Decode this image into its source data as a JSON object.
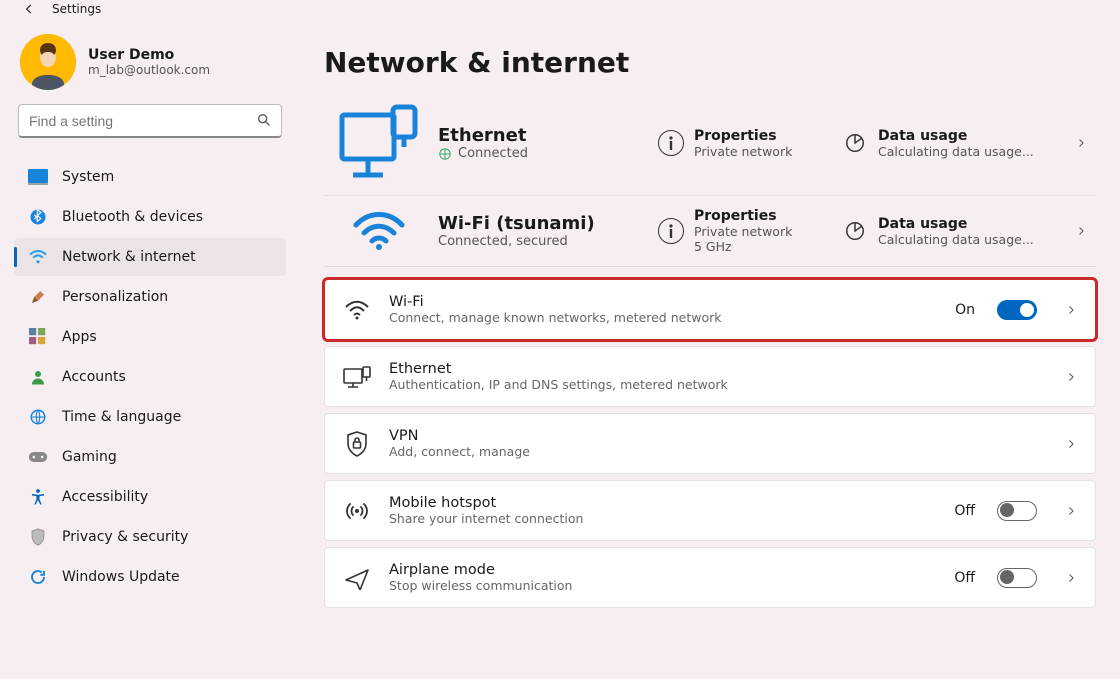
{
  "window": {
    "title": "Settings"
  },
  "user": {
    "name": "User Demo",
    "email": "m_lab@outlook.com"
  },
  "search": {
    "placeholder": "Find a setting"
  },
  "sidebar": {
    "items": [
      {
        "label": "System"
      },
      {
        "label": "Bluetooth & devices"
      },
      {
        "label": "Network & internet",
        "selected": true
      },
      {
        "label": "Personalization"
      },
      {
        "label": "Apps"
      },
      {
        "label": "Accounts"
      },
      {
        "label": "Time & language"
      },
      {
        "label": "Gaming"
      },
      {
        "label": "Accessibility"
      },
      {
        "label": "Privacy & security"
      },
      {
        "label": "Windows Update"
      }
    ]
  },
  "page": {
    "title": "Network & internet"
  },
  "connections": [
    {
      "name": "Ethernet",
      "status": "Connected",
      "properties": {
        "label": "Properties",
        "sub": "Private network"
      },
      "data_usage": {
        "label": "Data usage",
        "sub": "Calculating data usage..."
      }
    },
    {
      "name": "Wi-Fi (tsunami)",
      "status": "Connected, secured",
      "extra": "5 GHz",
      "properties": {
        "label": "Properties",
        "sub": "Private network"
      },
      "data_usage": {
        "label": "Data usage",
        "sub": "Calculating data usage..."
      }
    }
  ],
  "cards": {
    "wifi": {
      "title": "Wi-Fi",
      "sub": "Connect, manage known networks, metered network",
      "toggle_state": "On"
    },
    "eth": {
      "title": "Ethernet",
      "sub": "Authentication, IP and DNS settings, metered network"
    },
    "vpn": {
      "title": "VPN",
      "sub": "Add, connect, manage"
    },
    "hotspot": {
      "title": "Mobile hotspot",
      "sub": "Share your internet connection",
      "toggle_state": "Off"
    },
    "air": {
      "title": "Airplane mode",
      "sub": "Stop wireless communication",
      "toggle_state": "Off"
    }
  }
}
